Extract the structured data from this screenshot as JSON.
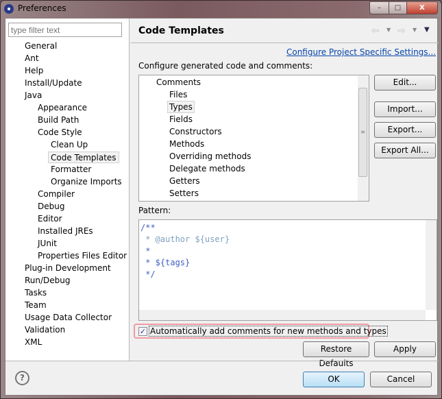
{
  "window": {
    "title": "Preferences",
    "minimize": "–",
    "maximize": "□",
    "close": "X"
  },
  "sidebar": {
    "filter_placeholder": "type filter text",
    "items": [
      {
        "label": "General",
        "level": 1
      },
      {
        "label": "Ant",
        "level": 1
      },
      {
        "label": "Help",
        "level": 1
      },
      {
        "label": "Install/Update",
        "level": 1
      },
      {
        "label": "Java",
        "level": 1
      },
      {
        "label": "Appearance",
        "level": 2
      },
      {
        "label": "Build Path",
        "level": 2
      },
      {
        "label": "Code Style",
        "level": 2
      },
      {
        "label": "Clean Up",
        "level": 3
      },
      {
        "label": "Code Templates",
        "level": 3,
        "selected": true
      },
      {
        "label": "Formatter",
        "level": 3
      },
      {
        "label": "Organize Imports",
        "level": 3
      },
      {
        "label": "Compiler",
        "level": 2
      },
      {
        "label": "Debug",
        "level": 2
      },
      {
        "label": "Editor",
        "level": 2
      },
      {
        "label": "Installed JREs",
        "level": 2
      },
      {
        "label": "JUnit",
        "level": 2
      },
      {
        "label": "Properties Files Editor",
        "level": 2
      },
      {
        "label": "Plug-in Development",
        "level": 1
      },
      {
        "label": "Run/Debug",
        "level": 1
      },
      {
        "label": "Tasks",
        "level": 1
      },
      {
        "label": "Team",
        "level": 1
      },
      {
        "label": "Usage Data Collector",
        "level": 1
      },
      {
        "label": "Validation",
        "level": 1
      },
      {
        "label": "XML",
        "level": 1
      }
    ]
  },
  "main": {
    "title": "Code Templates",
    "nav": {
      "back": "⇦",
      "forward": "⇨",
      "menu": "▼"
    },
    "config_link": "Configure Project Specific Settings...",
    "list_label": "Configure generated code and comments:",
    "tree": {
      "root": "Comments",
      "children": [
        "Files",
        "Types",
        "Fields",
        "Constructors",
        "Methods",
        "Overriding methods",
        "Delegate methods",
        "Getters",
        "Setters"
      ],
      "selected": "Types"
    },
    "buttons": {
      "edit": "Edit...",
      "import": "Import...",
      "export": "Export...",
      "export_all": "Export All..."
    },
    "pattern_label": "Pattern:",
    "pattern_lines": [
      "/**",
      " * @author ${user}",
      " *",
      " * ${tags}",
      " */"
    ],
    "auto_comment": {
      "label": "Automatically add comments for new methods and types",
      "checked": true
    },
    "restore_defaults": "Restore Defaults",
    "apply": "Apply"
  },
  "footer": {
    "help": "?",
    "ok": "OK",
    "cancel": "Cancel"
  },
  "colors": {
    "comment": "#3f5fbf",
    "tag": "#7f9fbf",
    "highlight": "#e8303a",
    "link": "#0645ad"
  }
}
